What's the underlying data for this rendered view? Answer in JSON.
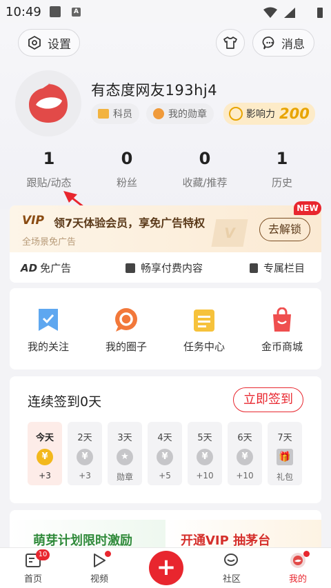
{
  "status": {
    "time": "10:49",
    "a_label": "A"
  },
  "header": {
    "settings": "设置",
    "messages": "消息"
  },
  "user": {
    "name": "有态度网友193hj4",
    "badge1": "科员",
    "badge2": "我的勋章",
    "influence_label": "影响力",
    "influence_value": "200"
  },
  "stats": [
    {
      "value": "1",
      "label": "跟贴/动态"
    },
    {
      "value": "0",
      "label": "粉丝"
    },
    {
      "value": "0",
      "label": "收藏/推荐"
    },
    {
      "value": "1",
      "label": "历史"
    }
  ],
  "vip": {
    "logo": "VIP",
    "title": "领7天体验会员，享免广告特权",
    "subtitle": "全场景免广告",
    "button": "去解锁",
    "new_badge": "NEW",
    "watermark": "V",
    "perk1_icon": "AD",
    "perk1": "免广告",
    "perk2": "畅享付费内容",
    "perk3": "专属栏目"
  },
  "grid": [
    {
      "label": "我的关注",
      "icon": "bookmark-icon"
    },
    {
      "label": "我的圈子",
      "icon": "circle-chat-icon"
    },
    {
      "label": "任务中心",
      "icon": "task-list-icon"
    },
    {
      "label": "金币商城",
      "icon": "shopping-bag-icon"
    }
  ],
  "checkin": {
    "title": "连续签到0天",
    "button": "立即签到",
    "days": [
      {
        "day": "今天",
        "reward": "+3",
        "coin": "¥"
      },
      {
        "day": "2天",
        "reward": "+3",
        "coin": "¥"
      },
      {
        "day": "3天",
        "reward": "勋章",
        "coin": "★"
      },
      {
        "day": "4天",
        "reward": "+5",
        "coin": "¥"
      },
      {
        "day": "5天",
        "reward": "+10",
        "coin": "¥"
      },
      {
        "day": "6天",
        "reward": "+10",
        "coin": "¥"
      },
      {
        "day": "7天",
        "reward": "礼包",
        "coin": "🎁"
      }
    ]
  },
  "promo": {
    "left": "萌芽计划限时激励",
    "right": "开通VIP 抽茅台"
  },
  "nav": {
    "home": "首页",
    "home_badge": "10",
    "video": "视频",
    "community": "社区",
    "mine": "我的",
    "publish": "+"
  },
  "colors": {
    "accent": "#e8262e",
    "gold": "#e8a400"
  }
}
